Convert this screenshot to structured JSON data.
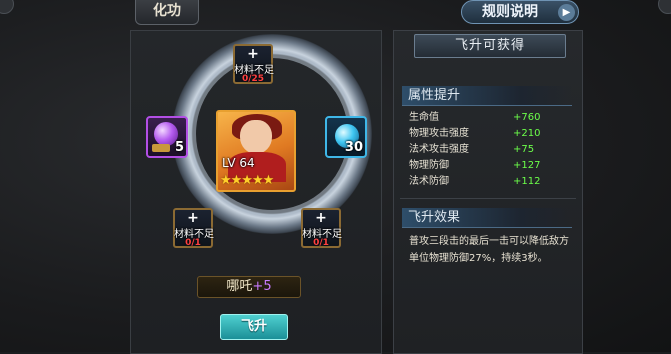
{
  "top": {
    "tab_label": "化功",
    "rules_label": "规则说明",
    "rules_arrow": "▶"
  },
  "slots": {
    "top": {
      "plus": "+",
      "need": "材料不足",
      "count": "0/25"
    },
    "bottom_left": {
      "plus": "+",
      "need": "材料不足",
      "count": "0/1"
    },
    "bottom_right": {
      "plus": "+",
      "need": "材料不足",
      "count": "0/1"
    },
    "left_count": "5",
    "right_count": "30"
  },
  "hero": {
    "level": "LV 64",
    "stars": "★★★★★",
    "star_count": 5,
    "name": "哪吒",
    "plus": "+5"
  },
  "fly_button": "飞升",
  "right_panel": {
    "title": "飞升可获得",
    "attr_header": "属性提升",
    "stats": [
      {
        "k": "生命值",
        "v": "+760"
      },
      {
        "k": "物理攻击强度",
        "v": "+210"
      },
      {
        "k": "法术攻击强度",
        "v": "+75"
      },
      {
        "k": "物理防御",
        "v": "+127"
      },
      {
        "k": "法术防御",
        "v": "+112"
      }
    ],
    "effect_header": "飞升效果",
    "effect_text": "普攻三段击的最后一击可以降低敌方单位物理防御27%，持续3秒。"
  },
  "colors": {
    "stat_value": "#6cff4a",
    "need_count": "#ff4040",
    "plus_level": "#c97cff",
    "hero_frame": "#e8a030"
  }
}
